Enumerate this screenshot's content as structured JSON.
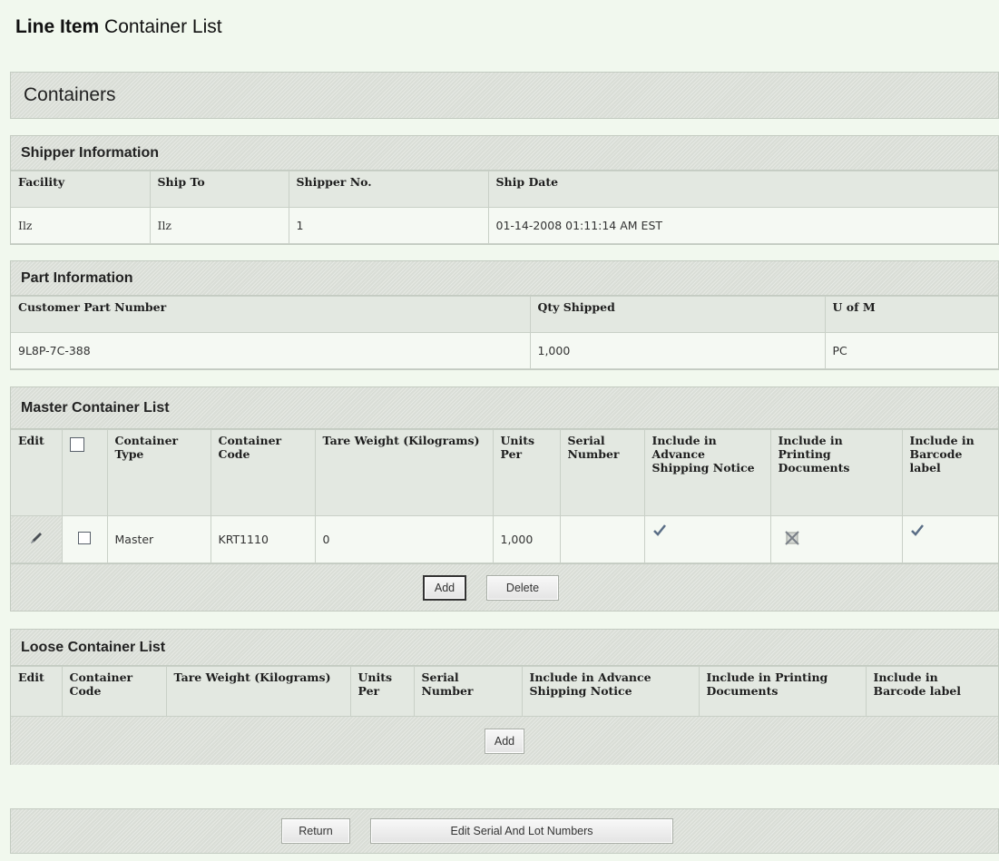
{
  "page_title": {
    "bold": "Line Item",
    "rest": " Container List"
  },
  "containers_title": "Containers",
  "shipper": {
    "title": "Shipper Information",
    "headers": [
      "Facility",
      "Ship To",
      "Shipper No.",
      "Ship Date"
    ],
    "row": [
      "Ilz",
      "Ilz",
      "1",
      "01-14-2008 01:11:14 AM EST"
    ]
  },
  "part": {
    "title": "Part Information",
    "headers": [
      "Customer Part Number",
      "Qty Shipped",
      "U of M"
    ],
    "row": [
      "9L8P-7C-388",
      "1,000",
      "PC"
    ]
  },
  "master": {
    "title": "Master Container List",
    "headers": [
      "Edit",
      "",
      "Container Type",
      "Container Code",
      "Tare Weight (Kilograms)",
      "Units Per",
      "Serial Number",
      "Include in Advance Shipping Notice",
      "Include in Printing Documents",
      "Include in Barcode label"
    ],
    "rows": [
      {
        "type": "Master",
        "code": "KRT1110",
        "tare": "0",
        "units": "1,000",
        "serial": "",
        "asn": "check-icon",
        "print": "x-icon",
        "barcode": "check-icon"
      }
    ],
    "add_label": "Add",
    "delete_label": "Delete"
  },
  "loose": {
    "title": "Loose Container List",
    "headers": [
      "Edit",
      "Container Code",
      "Tare Weight (Kilograms)",
      "Units Per",
      "Serial Number",
      "Include in Advance Shipping Notice",
      "Include in Printing Documents",
      "Include in Barcode label"
    ],
    "add_label": "Add"
  },
  "footer": {
    "return_label": "Return",
    "edit_serial_label": "Edit Serial And Lot Numbers"
  },
  "colors": {
    "background": "#f1f8ee",
    "header_bg": "#e3e8e1",
    "title_bar": "#d9ddd6",
    "check": "#5a6e86"
  }
}
